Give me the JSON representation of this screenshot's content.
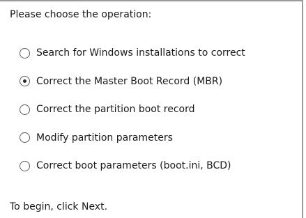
{
  "prompt": "Please choose the operation:",
  "options": [
    {
      "label": "Search for Windows installations to correct",
      "selected": false
    },
    {
      "label": "Correct the Master Boot Record (MBR)",
      "selected": true
    },
    {
      "label": "Correct the partition boot record",
      "selected": false
    },
    {
      "label": "Modify partition parameters",
      "selected": false
    },
    {
      "label": "Correct boot parameters (boot.ini, BCD)",
      "selected": false
    }
  ],
  "footer": "To begin, click Next."
}
